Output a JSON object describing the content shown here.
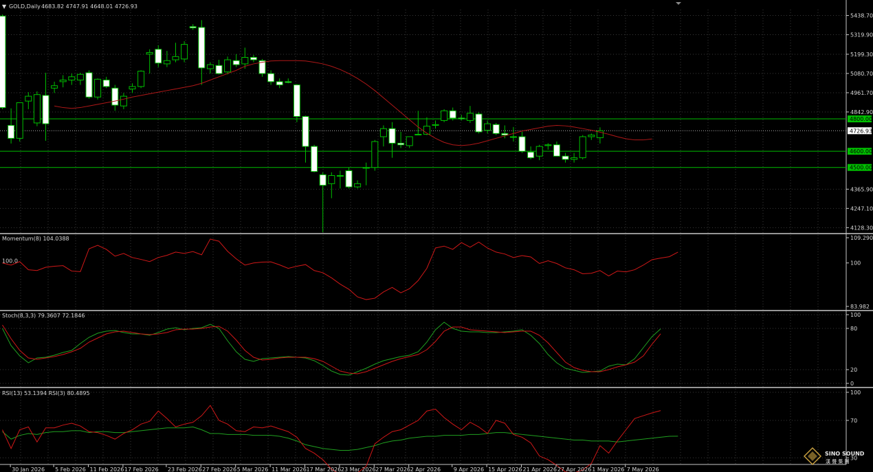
{
  "header": {
    "symbol": "GOLD,Daily",
    "ohlc": "4683.82 4747.91 4648.01 4726.93"
  },
  "colors": {
    "background": "#000000",
    "grid": "#3a3a3a",
    "bull": "#ffffff",
    "bear": "#000000",
    "wick": "#00c000",
    "ma": "#b01818",
    "level": "#00c000",
    "momentum": "#d01818",
    "stoch_main": "#20a020",
    "stoch_signal": "#d01818",
    "rsi13": "#20a020",
    "rsi3": "#d01818"
  },
  "chart_data": [
    {
      "type": "candlestick",
      "title": "GOLD,Daily",
      "ylim": [
        4080,
        5500
      ],
      "y_ticks": [
        "5438.70",
        "5319.90",
        "5199.30",
        "5080.70",
        "4961.70",
        "4842.90",
        "4365.90",
        "4247.10",
        "4128.30"
      ],
      "y_tick_values": [
        5438.7,
        5319.9,
        5199.3,
        5080.7,
        4961.7,
        4842.9,
        4365.9,
        4247.1,
        4128.3
      ],
      "x_labels": [
        "30 Jan 2026",
        "5 Feb 2026",
        "11 Feb 2026",
        "17 Feb 2026",
        "23 Feb 2026",
        "27 Feb 2026",
        "5 Mar 2026",
        "11 Mar 2026",
        "17 Mar 2026",
        "23 Mar 2026",
        "27 Mar 2026",
        "2 Apr 2026",
        "9 Apr 2026",
        "15 Apr 2026",
        "21 Apr 2026",
        "27 Apr 2026",
        "1 May 2026",
        "7 May 2026"
      ],
      "x_label_bars": [
        1,
        6,
        10,
        14,
        19,
        23,
        27,
        31,
        35,
        39,
        43,
        47,
        52,
        56,
        60,
        64,
        68,
        72
      ],
      "levels": [
        {
          "label": "4800.00",
          "value": 4800
        },
        {
          "label": "4600.00",
          "value": 4600
        },
        {
          "label": "4500.00",
          "value": 4500
        }
      ],
      "current": {
        "label": "4726.93",
        "value": 4726.93
      },
      "candles": [
        {
          "o": 5435,
          "h": 5445,
          "l": 4860,
          "c": 4870
        },
        {
          "o": 4760,
          "h": 4865,
          "l": 4648,
          "c": 4680
        },
        {
          "o": 4680,
          "h": 4900,
          "l": 4660,
          "c": 4900
        },
        {
          "o": 4910,
          "h": 4965,
          "l": 4860,
          "c": 4940
        },
        {
          "o": 4775,
          "h": 4970,
          "l": 4755,
          "c": 4950
        },
        {
          "o": 4945,
          "h": 5085,
          "l": 4665,
          "c": 4770
        },
        {
          "o": 4990,
          "h": 5030,
          "l": 4960,
          "c": 5005
        },
        {
          "o": 5030,
          "h": 5070,
          "l": 4995,
          "c": 5040
        },
        {
          "o": 5040,
          "h": 5080,
          "l": 5010,
          "c": 5060
        },
        {
          "o": 5040,
          "h": 5085,
          "l": 5010,
          "c": 5075
        },
        {
          "o": 5085,
          "h": 5100,
          "l": 4925,
          "c": 4935
        },
        {
          "o": 4935,
          "h": 5050,
          "l": 4920,
          "c": 5045
        },
        {
          "o": 5040,
          "h": 5060,
          "l": 4990,
          "c": 5000
        },
        {
          "o": 4990,
          "h": 5010,
          "l": 4850,
          "c": 4885
        },
        {
          "o": 4880,
          "h": 4960,
          "l": 4860,
          "c": 4940
        },
        {
          "o": 4985,
          "h": 5020,
          "l": 4960,
          "c": 5000
        },
        {
          "o": 5000,
          "h": 5100,
          "l": 4990,
          "c": 5095
        },
        {
          "o": 5200,
          "h": 5230,
          "l": 5080,
          "c": 5210
        },
        {
          "o": 5230,
          "h": 5255,
          "l": 5120,
          "c": 5145
        },
        {
          "o": 5140,
          "h": 5220,
          "l": 5120,
          "c": 5160
        },
        {
          "o": 5165,
          "h": 5270,
          "l": 5150,
          "c": 5185
        },
        {
          "o": 5170,
          "h": 5280,
          "l": 5150,
          "c": 5260
        },
        {
          "o": 5370,
          "h": 5385,
          "l": 5350,
          "c": 5362
        },
        {
          "o": 5365,
          "h": 5410,
          "l": 5010,
          "c": 5115
        },
        {
          "o": 5110,
          "h": 5150,
          "l": 5080,
          "c": 5135
        },
        {
          "o": 5130,
          "h": 5165,
          "l": 5075,
          "c": 5080
        },
        {
          "o": 5090,
          "h": 5185,
          "l": 5075,
          "c": 5165
        },
        {
          "o": 5160,
          "h": 5200,
          "l": 5120,
          "c": 5135
        },
        {
          "o": 5140,
          "h": 5240,
          "l": 5110,
          "c": 5180
        },
        {
          "o": 5180,
          "h": 5195,
          "l": 5150,
          "c": 5165
        },
        {
          "o": 5160,
          "h": 5170,
          "l": 5060,
          "c": 5080
        },
        {
          "o": 5080,
          "h": 5100,
          "l": 5010,
          "c": 5030
        },
        {
          "o": 5030,
          "h": 5050,
          "l": 4990,
          "c": 5010
        },
        {
          "o": 5030,
          "h": 5050,
          "l": 5020,
          "c": 5025
        },
        {
          "o": 5010,
          "h": 5015,
          "l": 4780,
          "c": 4815
        },
        {
          "o": 4815,
          "h": 4820,
          "l": 4530,
          "c": 4630
        },
        {
          "o": 4630,
          "h": 4640,
          "l": 4470,
          "c": 4475
        },
        {
          "o": 4455,
          "h": 4470,
          "l": 4100,
          "c": 4390
        },
        {
          "o": 4400,
          "h": 4470,
          "l": 4310,
          "c": 4450
        },
        {
          "o": 4450,
          "h": 4480,
          "l": 4370,
          "c": 4450
        },
        {
          "o": 4480,
          "h": 4500,
          "l": 4370,
          "c": 4380
        },
        {
          "o": 4380,
          "h": 4420,
          "l": 4370,
          "c": 4400
        },
        {
          "o": 4495,
          "h": 4530,
          "l": 4390,
          "c": 4500
        },
        {
          "o": 4500,
          "h": 4670,
          "l": 4480,
          "c": 4660
        },
        {
          "o": 4690,
          "h": 4760,
          "l": 4630,
          "c": 4740
        },
        {
          "o": 4740,
          "h": 4780,
          "l": 4560,
          "c": 4650
        },
        {
          "o": 4650,
          "h": 4720,
          "l": 4620,
          "c": 4640
        },
        {
          "o": 4635,
          "h": 4690,
          "l": 4620,
          "c": 4690
        },
        {
          "o": 4705,
          "h": 4850,
          "l": 4700,
          "c": 4705
        },
        {
          "o": 4705,
          "h": 4810,
          "l": 4700,
          "c": 4755
        },
        {
          "o": 4760,
          "h": 4790,
          "l": 4740,
          "c": 4765
        },
        {
          "o": 4790,
          "h": 4860,
          "l": 4780,
          "c": 4850
        },
        {
          "o": 4850,
          "h": 4870,
          "l": 4790,
          "c": 4805
        },
        {
          "o": 4805,
          "h": 4825,
          "l": 4790,
          "c": 4800
        },
        {
          "o": 4790,
          "h": 4880,
          "l": 4775,
          "c": 4835
        },
        {
          "o": 4830,
          "h": 4840,
          "l": 4710,
          "c": 4720
        },
        {
          "o": 4730,
          "h": 4790,
          "l": 4710,
          "c": 4770
        },
        {
          "o": 4765,
          "h": 4775,
          "l": 4700,
          "c": 4710
        },
        {
          "o": 4710,
          "h": 4760,
          "l": 4680,
          "c": 4700
        },
        {
          "o": 4690,
          "h": 4750,
          "l": 4660,
          "c": 4690
        },
        {
          "o": 4690,
          "h": 4720,
          "l": 4590,
          "c": 4600
        },
        {
          "o": 4595,
          "h": 4630,
          "l": 4550,
          "c": 4560
        },
        {
          "o": 4570,
          "h": 4640,
          "l": 4545,
          "c": 4630
        },
        {
          "o": 4635,
          "h": 4650,
          "l": 4610,
          "c": 4640
        },
        {
          "o": 4640,
          "h": 4660,
          "l": 4570,
          "c": 4570
        },
        {
          "o": 4570,
          "h": 4590,
          "l": 4530,
          "c": 4550
        },
        {
          "o": 4550,
          "h": 4590,
          "l": 4530,
          "c": 4560
        },
        {
          "o": 4560,
          "h": 4700,
          "l": 4550,
          "c": 4690
        },
        {
          "o": 4690,
          "h": 4710,
          "l": 4670,
          "c": 4700
        },
        {
          "o": 4683.82,
          "h": 4747.91,
          "l": 4648.01,
          "c": 4726.93
        }
      ],
      "ma": [
        4880,
        4870,
        4865,
        4870,
        4880,
        4890,
        4900,
        4910,
        4922,
        4935,
        4945,
        4955,
        4965,
        4975,
        4985,
        4995,
        5005,
        5020,
        5040,
        5060,
        5080,
        5100,
        5125,
        5140,
        5150,
        5158,
        5160,
        5160,
        5160,
        5158,
        5150,
        5140,
        5125,
        5105,
        5080,
        5050,
        5015,
        4975,
        4930,
        4885,
        4840,
        4795,
        4750,
        4712,
        4680,
        4655,
        4640,
        4635,
        4640,
        4650,
        4665,
        4680,
        4695,
        4710,
        4725,
        4735,
        4745,
        4755,
        4760,
        4757,
        4750,
        4740,
        4730,
        4718,
        4705,
        4690,
        4677,
        4670,
        4670,
        4676
      ]
    },
    {
      "type": "line",
      "title": "Momentum(8) 104.0388",
      "ylim": [
        83.982,
        109.2906
      ],
      "y_ticks": [
        "109.2906",
        "100",
        "83.982"
      ],
      "y_tick_values": [
        109.2906,
        100,
        83.982
      ],
      "levels": [
        {
          "label": "100.0",
          "value": 100
        }
      ],
      "series": [
        {
          "name": "Momentum(8)",
          "color": "#d01818",
          "values": [
            100,
            99.2,
            100.5,
            97.5,
            97.2,
            98.4,
            98.8,
            99.0,
            97.0,
            96.8,
            105.2,
            106.5,
            105.0,
            102.5,
            103.5,
            102.0,
            101.3,
            100.5,
            102.0,
            102.8,
            104.0,
            103.5,
            104.2,
            103.0,
            108.8,
            108.0,
            104.3,
            101.5,
            99.2,
            100.0,
            100.3,
            100.4,
            99.3,
            98.0,
            98.8,
            99.4,
            97.2,
            96.4,
            94.5,
            92.2,
            90.3,
            87.5,
            86.5,
            87.0,
            89.3,
            91.0,
            89.0,
            90.5,
            93.5,
            98.0,
            105.5,
            106.2,
            105.0,
            107.5,
            105.8,
            107.7,
            105.5,
            104.0,
            103.3,
            102.0,
            102.7,
            102.2,
            99.8,
            100.8,
            99.8,
            98.2,
            97.5,
            96.0,
            96.2,
            97.2,
            95.2,
            97.0,
            96.7,
            97.5,
            99.2,
            101.2,
            101.8,
            102.3,
            104.0
          ]
        }
      ]
    },
    {
      "type": "line",
      "title": "Stoch(8,3,3) 79.3607 72.1846",
      "ylim": [
        0,
        100
      ],
      "y_ticks": [
        "100",
        "80",
        "20",
        "0"
      ],
      "y_tick_values": [
        100,
        80,
        20,
        0
      ],
      "series": [
        {
          "name": "Main",
          "color": "#20a020",
          "values": [
            80,
            55,
            40,
            30,
            37,
            38,
            41,
            45,
            48,
            58,
            67,
            73,
            76,
            77,
            74,
            72,
            72,
            70,
            74,
            79,
            81,
            78,
            80,
            81,
            86,
            80,
            62,
            46,
            35,
            32,
            36,
            37,
            38,
            39,
            38,
            37,
            33,
            26,
            18,
            13,
            12,
            17,
            22,
            28,
            33,
            36,
            39,
            41,
            46,
            60,
            78,
            89,
            80,
            76,
            75,
            75,
            74,
            74,
            75,
            76,
            78,
            70,
            58,
            42,
            30,
            22,
            19,
            16,
            17,
            18,
            25,
            28,
            27,
            36,
            52,
            68,
            79.3607
          ]
        },
        {
          "name": "Signal",
          "color": "#d01818",
          "values": [
            85,
            65,
            48,
            37,
            35,
            37,
            39,
            42,
            46,
            51,
            60,
            66,
            72,
            75,
            76,
            74,
            72,
            71,
            72,
            74,
            78,
            79,
            79,
            80,
            82,
            83,
            76,
            63,
            48,
            38,
            34,
            35,
            37,
            38,
            38,
            38,
            36,
            32,
            25,
            18,
            15,
            14,
            17,
            22,
            27,
            32,
            36,
            39,
            42,
            49,
            61,
            76,
            82,
            82,
            78,
            77,
            76,
            75,
            74,
            75,
            76,
            76,
            70,
            59,
            45,
            31,
            23,
            19,
            17,
            17,
            20,
            24,
            27,
            31,
            40,
            57,
            72.1846
          ]
        }
      ]
    },
    {
      "type": "line",
      "title": "RSI(13) 53.1394 RSI(3) 80.4895",
      "ylim": [
        20,
        100
      ],
      "y_ticks": [
        "100",
        "70",
        "30"
      ],
      "y_tick_values": [
        100,
        70,
        30
      ],
      "series": [
        {
          "name": "RSI(13)",
          "color": "#20a020",
          "values": [
            58,
            50,
            54,
            56,
            55,
            57,
            58,
            58,
            59,
            59,
            57,
            58,
            58,
            57,
            57,
            58,
            59,
            60,
            61,
            62,
            62,
            62,
            63,
            60,
            56,
            56,
            55,
            55,
            55,
            54,
            54,
            54,
            53,
            51,
            48,
            44,
            42,
            40,
            39,
            38,
            38,
            39,
            41,
            43,
            46,
            48,
            49,
            51,
            52,
            53,
            53,
            54,
            54,
            54,
            55,
            55,
            56,
            57,
            57,
            56,
            55,
            54,
            53,
            52,
            51,
            50,
            49,
            49,
            48,
            48,
            48,
            47,
            48,
            49,
            50,
            51,
            52,
            53,
            53.1394
          ]
        },
        {
          "name": "RSI(3)",
          "color": "#d01818",
          "values": [
            60,
            40,
            60,
            63,
            47,
            62,
            62,
            65,
            67,
            64,
            58,
            57,
            54,
            50,
            56,
            60,
            66,
            69,
            80,
            72,
            63,
            66,
            68,
            75,
            86,
            70,
            66,
            59,
            58,
            63,
            62,
            64,
            61,
            58,
            52,
            40,
            35,
            28,
            18,
            12,
            10,
            14,
            21,
            45,
            52,
            58,
            60,
            65,
            70,
            80,
            82,
            73,
            66,
            60,
            68,
            63,
            56,
            70,
            67,
            55,
            52,
            46,
            32,
            28,
            22,
            15,
            14,
            17,
            24,
            43,
            35,
            48,
            60,
            72,
            75,
            78,
            80.4895
          ]
        }
      ]
    }
  ],
  "logo": {
    "name": "SINO SOUND",
    "sub": "漢 聲 集 團"
  }
}
